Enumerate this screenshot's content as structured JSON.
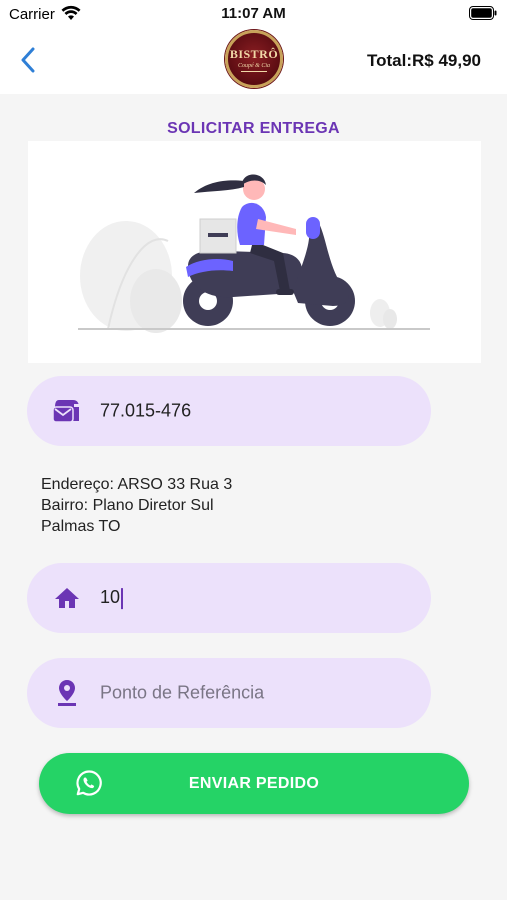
{
  "status_bar": {
    "carrier": "Carrier",
    "time": "11:07 AM"
  },
  "header": {
    "total": "Total:R$ 49,90",
    "logo_text": "BISTRÔ",
    "logo_subtext": "Coupé & Cia"
  },
  "section_title": "SOLICITAR ENTREGA",
  "cep_field": {
    "value": "77.015-476",
    "icon": "mailbox-icon"
  },
  "address": {
    "line1": "Endereço: ARSO 33 Rua 3",
    "line2": "Bairro: Plano Diretor Sul",
    "line3": "Palmas TO"
  },
  "number_field": {
    "value": "10",
    "icon": "home-icon"
  },
  "reference_field": {
    "placeholder": "Ponto de Referência",
    "icon": "location-pin-icon"
  },
  "send_button": {
    "label": "ENVIAR PEDIDO",
    "icon": "whatsapp-icon"
  },
  "colors": {
    "accent": "#6b35b4",
    "pill": "#ece1fb",
    "send": "#25d366",
    "back": "#2f7fd6"
  }
}
